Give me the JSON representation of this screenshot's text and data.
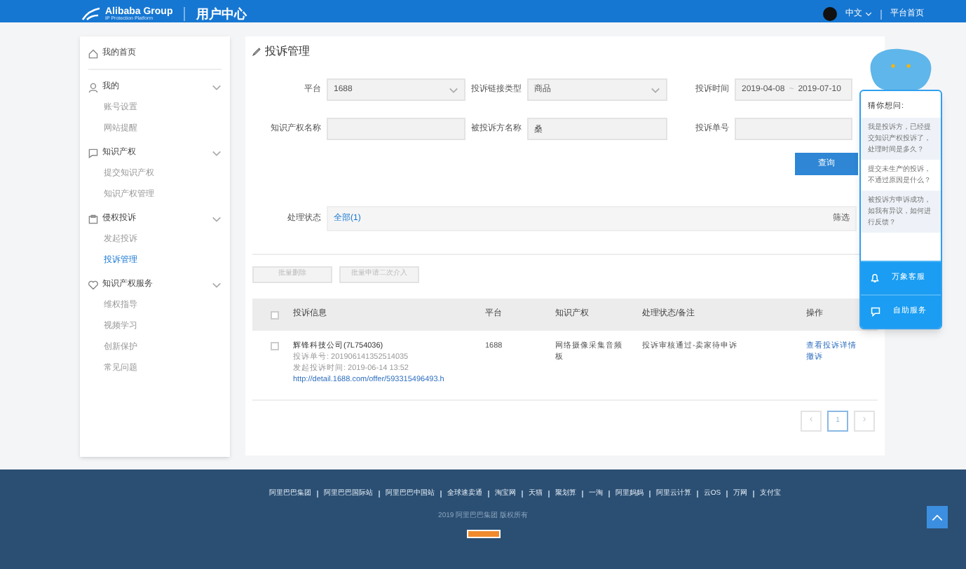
{
  "header": {
    "logo_text": "Alibaba Group",
    "logo_subtitle": "IP Protection Platform",
    "title": "用户中心",
    "language": "中文",
    "home_link": "平台首页"
  },
  "sidebar": {
    "items": [
      {
        "label": "我的首页",
        "kind": "link",
        "selected": false
      },
      {
        "label": "我的",
        "kind": "group",
        "expanded": true,
        "children": [
          {
            "label": "账号设置",
            "selected": false
          },
          {
            "label": "网站提醒",
            "selected": false
          }
        ]
      },
      {
        "label": "知识产权",
        "kind": "group",
        "expanded": true,
        "children": [
          {
            "label": "提交知识产权",
            "selected": false
          },
          {
            "label": "知识产权管理",
            "selected": false
          }
        ]
      },
      {
        "label": "侵权投诉",
        "kind": "group",
        "expanded": true,
        "children": [
          {
            "label": "发起投诉",
            "selected": false
          },
          {
            "label": "投诉管理",
            "selected": true
          }
        ]
      },
      {
        "label": "知识产权服务",
        "kind": "group",
        "expanded": true,
        "children": [
          {
            "label": "维权指导",
            "selected": false
          },
          {
            "label": "视频学习",
            "selected": false
          },
          {
            "label": "创新保护",
            "selected": false
          },
          {
            "label": "常见问题",
            "selected": false
          }
        ]
      }
    ]
  },
  "page_title": "投诉管理",
  "filters": [
    {
      "label": "平台",
      "kind": "select",
      "value": "1688"
    },
    {
      "label": "投诉链接类型",
      "kind": "select",
      "value": "商品"
    },
    {
      "label": "投诉时间",
      "kind": "date",
      "from": "2019-04-08",
      "separator": "~",
      "to": "2019-07-10"
    },
    {
      "label": "知识产权名称",
      "kind": "text"
    },
    {
      "label": "被投诉方名称",
      "kind": "text",
      "value": "桑"
    },
    {
      "label": "投诉单号",
      "kind": "text"
    }
  ],
  "query_button": "查询",
  "status_filter": {
    "label": "处理状态",
    "options": [
      {
        "label": "全部(1)",
        "selected": true
      }
    ],
    "right_label": "筛选"
  },
  "bulk_buttons": [
    {
      "label": "批量删除",
      "disabled": true
    },
    {
      "label": "批量申请二次介入",
      "disabled": true
    }
  ],
  "table": {
    "all_checked": false,
    "columns": [
      "投诉信息",
      "平台",
      "知识产权",
      "处理状态/备注",
      "操作"
    ],
    "rows": [
      {
        "checked": false,
        "seller": "辉锋科技公司(7L754036)",
        "complaint_no": "投诉单号: 201906141352514035",
        "time": "发起投诉时间: 2019-06-14 13:52",
        "url": "http://detail.1688.com/offer/593315496493.h",
        "platform": "1688",
        "ip": "网络摄像采集音频板",
        "status": "投诉审核通过-卖家待申诉",
        "actions": [
          "查看投诉详情",
          "撤诉"
        ]
      }
    ]
  },
  "pagination": {
    "prev": "‹",
    "pages": [
      {
        "label": "1",
        "selected": true
      }
    ],
    "next": "›"
  },
  "chat": {
    "title": "猜你想问:",
    "questions": [
      "我是投诉方，已经提交知识产权投诉了，处理时间是多久？",
      "提交未生产的投诉，不通过原因是什么？",
      "被投诉方申诉成功，如我有异议，如何进行反馈？"
    ],
    "buttons": [
      {
        "label": "万象客服",
        "kind": "bell"
      },
      {
        "label": "自助服务",
        "kind": "chat"
      }
    ]
  },
  "footer": {
    "links": [
      "阿里巴巴集团",
      "阿里巴巴国际站",
      "阿里巴巴中国站",
      "全球速卖通",
      "淘宝网",
      "天猫",
      "聚划算",
      "一淘",
      "阿里妈妈",
      "阿里云计算",
      "云OS",
      "万网",
      "支付宝"
    ],
    "copyright": "2019 阿里巴巴集团 版权所有"
  }
}
